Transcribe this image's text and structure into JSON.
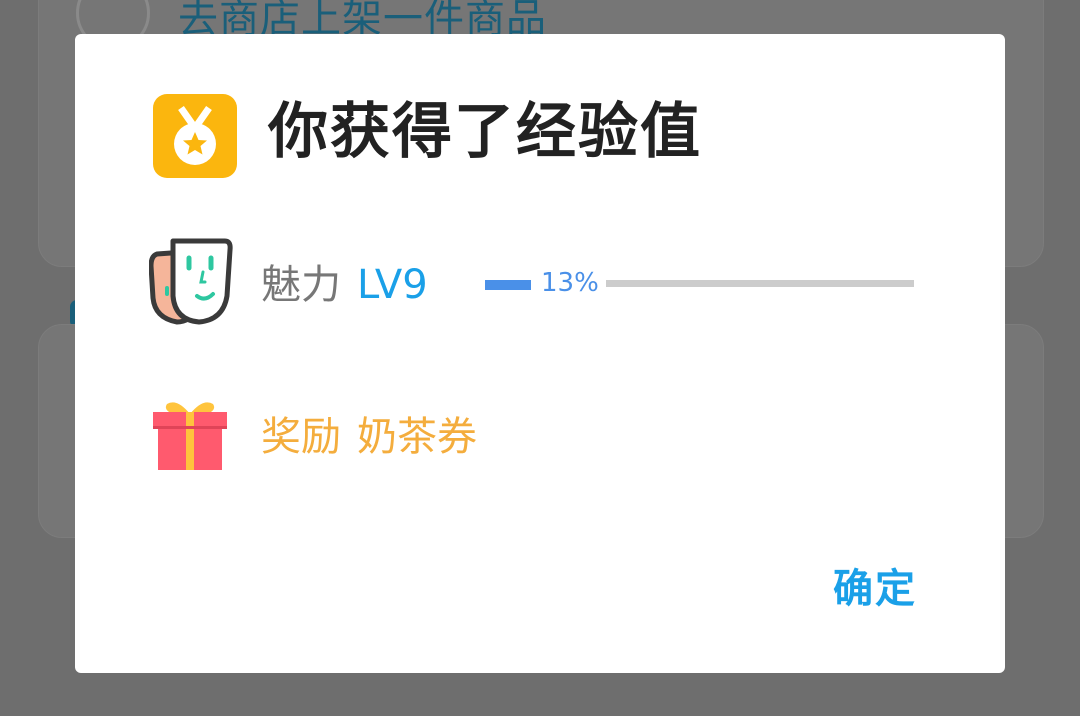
{
  "background": {
    "task_text": "去商店上架一件商品"
  },
  "dialog": {
    "title": "你获得了经验值",
    "title_icon": "medal-icon",
    "charm": {
      "icon": "face-mask-icon",
      "label": "魅力",
      "level": "LV9",
      "progress_text": "13%",
      "progress_fraction": 0.13
    },
    "reward": {
      "icon": "gift-icon",
      "label": "奖励",
      "value": "奶茶券"
    },
    "confirm_label": "确定"
  },
  "colors": {
    "accent_blue": "#1aa0e8",
    "progress_blue": "#4a90e8",
    "reward_orange": "#f4ad3d",
    "medal_yellow": "#fbb60e",
    "overlay_gray": "#6e6e6e"
  }
}
